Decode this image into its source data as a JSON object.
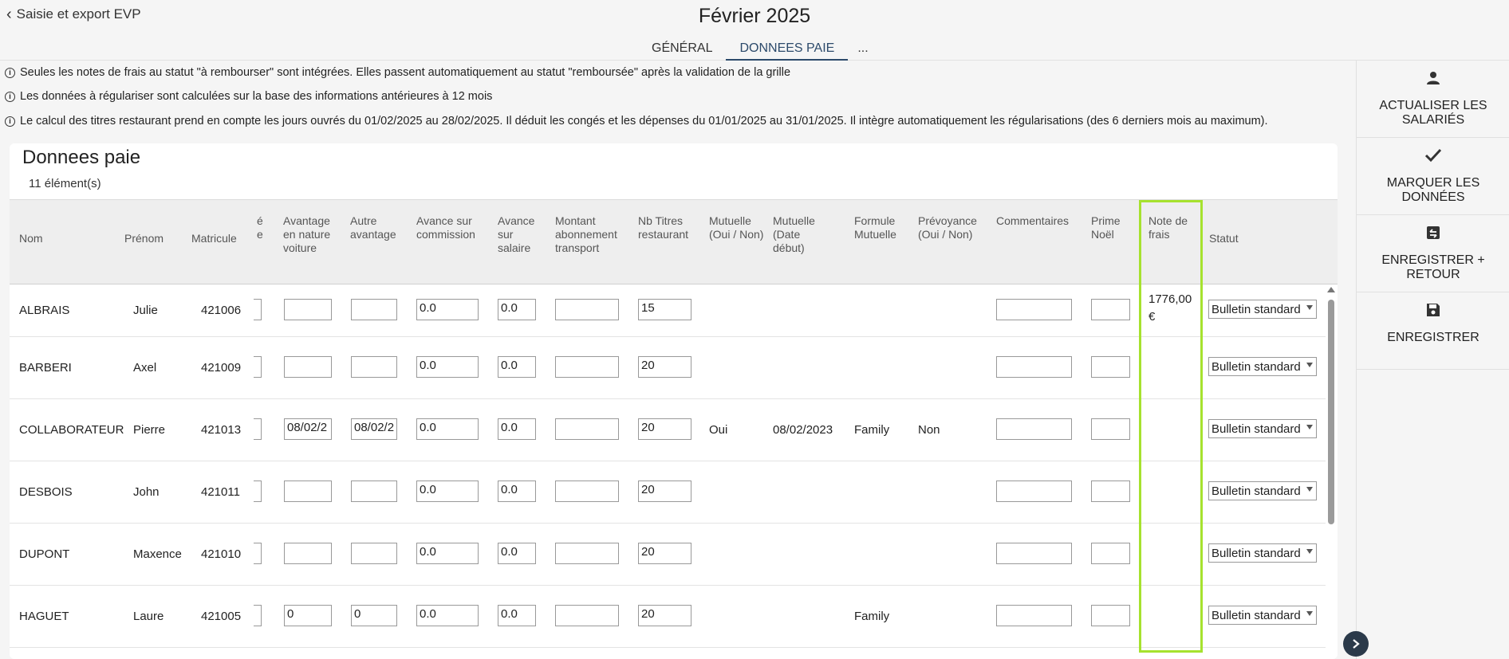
{
  "header": {
    "back_label": "Saisie et export EVP",
    "title": "Février 2025",
    "tabs": [
      {
        "label": "GÉNÉRAL"
      },
      {
        "label": "DONNEES PAIE"
      },
      {
        "label": "..."
      }
    ]
  },
  "notices": [
    "Seules les notes de frais au statut \"à rembourser\" sont intégrées. Elles passent automatiquement au statut \"remboursée\" après la validation de la grille",
    "Les données à régulariser sont calculées sur la base des informations antérieures à 12 mois",
    "Le calcul des titres restaurant prend en compte les jours ouvrés du 01/02/2025 au 28/02/2025. Il déduit les congés et les dépenses du 01/01/2025 au 31/01/2025. Il intègre automatiquement les régularisations (des 6 derniers mois au maximum)."
  ],
  "sidebar": {
    "actions": [
      {
        "label": "ACTUALISER LES SALARIÉS",
        "icon": "person-icon"
      },
      {
        "label": "MARQUER LES DONNÉES",
        "icon": "check-icon"
      },
      {
        "label": "ENREGISTRER + RETOUR",
        "icon": "save-return-icon"
      },
      {
        "label": "ENREGISTRER",
        "icon": "save-icon"
      }
    ]
  },
  "table": {
    "title": "Donnees paie",
    "count": "11 élément(s)",
    "headers": {
      "nom": "Nom",
      "prenom": "Prénom",
      "matricule": "Matricule",
      "clipped": "é e",
      "avantage_voiture": "Avantage en nature voiture",
      "autre_avantage": "Autre avantage",
      "avance_commission": "Avance sur commission",
      "avance_salaire": "Avance sur salaire",
      "abonnement_transport": "Montant abonnement transport",
      "titres_restaurant": "Nb Titres restaurant",
      "mutuelle": "Mutuelle (Oui / Non)",
      "mutuelle_date": "Mutuelle (Date début)",
      "formule_mutuelle": "Formule Mutuelle",
      "prevoyance": "Prévoyance (Oui / Non)",
      "commentaires": "Commentaires",
      "prime_noel": "Prime Noël",
      "note_frais": "Note de frais",
      "statut": "Statut"
    },
    "rows": [
      {
        "nom": "ALBRAIS",
        "prenom": "Julie",
        "matricule": "421006",
        "avantage_voiture": "",
        "autre_avantage": "",
        "avance_commission": "0.0",
        "avance_salaire": "0.0",
        "transport": "",
        "titres": "15",
        "mutuelle": "",
        "mutuelle_date": "",
        "formule": "",
        "prevoyance": "",
        "commentaire": "",
        "prime_noel": "",
        "note_frais": "1776,00 €",
        "statut": "Bulletin standard"
      },
      {
        "nom": "BARBERI",
        "prenom": "Axel",
        "matricule": "421009",
        "avantage_voiture": "",
        "autre_avantage": "",
        "avance_commission": "0.0",
        "avance_salaire": "0.0",
        "transport": "",
        "titres": "20",
        "mutuelle": "",
        "mutuelle_date": "",
        "formule": "",
        "prevoyance": "",
        "commentaire": "",
        "prime_noel": "",
        "note_frais": "",
        "statut": "Bulletin standard"
      },
      {
        "nom": "COLLABORATEUR",
        "prenom": "Pierre",
        "matricule": "421013",
        "avantage_voiture": "08/02/2",
        "autre_avantage": "08/02/2",
        "avance_commission": "0.0",
        "avance_salaire": "0.0",
        "transport": "",
        "titres": "20",
        "mutuelle": "Oui",
        "mutuelle_date": "08/02/2023",
        "formule": "Family",
        "prevoyance": "Non",
        "commentaire": "",
        "prime_noel": "",
        "note_frais": "",
        "statut": "Bulletin standard"
      },
      {
        "nom": "DESBOIS",
        "prenom": "John",
        "matricule": "421011",
        "avantage_voiture": "",
        "autre_avantage": "",
        "avance_commission": "0.0",
        "avance_salaire": "0.0",
        "transport": "",
        "titres": "20",
        "mutuelle": "",
        "mutuelle_date": "",
        "formule": "",
        "prevoyance": "",
        "commentaire": "",
        "prime_noel": "",
        "note_frais": "",
        "statut": "Bulletin standard"
      },
      {
        "nom": "DUPONT",
        "prenom": "Maxence",
        "matricule": "421010",
        "avantage_voiture": "",
        "autre_avantage": "",
        "avance_commission": "0.0",
        "avance_salaire": "0.0",
        "transport": "",
        "titres": "20",
        "mutuelle": "",
        "mutuelle_date": "",
        "formule": "",
        "prevoyance": "",
        "commentaire": "",
        "prime_noel": "",
        "note_frais": "",
        "statut": "Bulletin standard"
      },
      {
        "nom": "HAGUET",
        "prenom": "Laure",
        "matricule": "421005",
        "avantage_voiture": "0",
        "autre_avantage": "0",
        "avance_commission": "0.0",
        "avance_salaire": "0.0",
        "transport": "",
        "titres": "20",
        "mutuelle": "",
        "mutuelle_date": "",
        "formule": "Family",
        "prevoyance": "",
        "commentaire": "",
        "prime_noel": "",
        "note_frais": "",
        "statut": "Bulletin standard"
      }
    ]
  },
  "colors": {
    "highlight": "#a6e22e",
    "tab_active": "#2c4a6b"
  }
}
